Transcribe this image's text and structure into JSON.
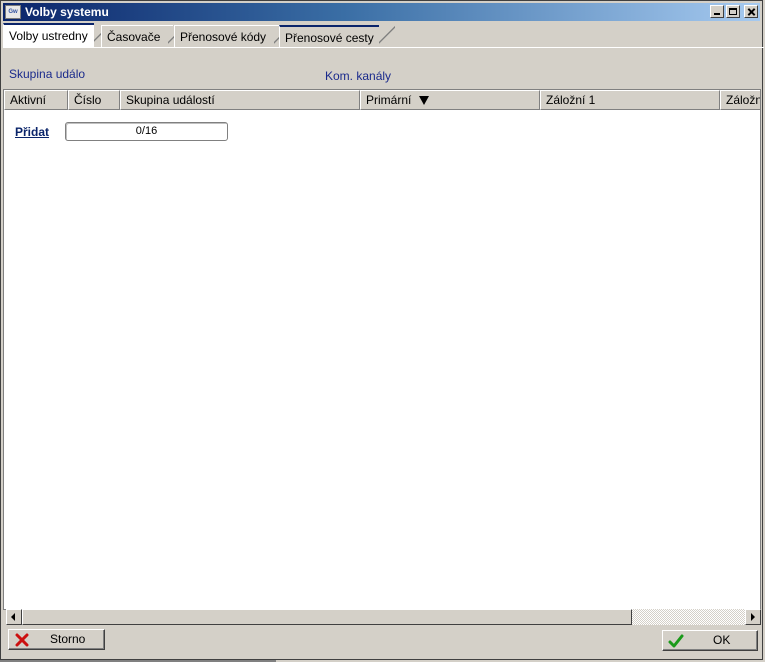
{
  "window": {
    "title": "Volby systemu",
    "app_icon": "app-icon"
  },
  "tabs": [
    {
      "label": "Volby ustredny",
      "active": true
    },
    {
      "label": "Časovače",
      "active": false
    },
    {
      "label": "Přenosové kódy",
      "active": false
    },
    {
      "label": "Přenosové cesty",
      "active": false
    }
  ],
  "sections": {
    "group_label": "Skupina událo",
    "channels_label": "Kom. kanály"
  },
  "table": {
    "columns": [
      "Aktivní",
      "Číslo",
      "Skupina událostí",
      "Primární",
      "Záložní 1",
      "Záložn"
    ],
    "sorted_column": "Primární",
    "sort_direction": "descending"
  },
  "add": {
    "label": "Přidat",
    "counter": "0/16"
  },
  "buttons": {
    "cancel_label": "Storno",
    "ok_label": "OK"
  },
  "colors": {
    "accent": "#0a246a",
    "section_text": "#1a2a8c",
    "cancel_icon": "#cc1010",
    "ok_icon": "#1a9a1a"
  }
}
